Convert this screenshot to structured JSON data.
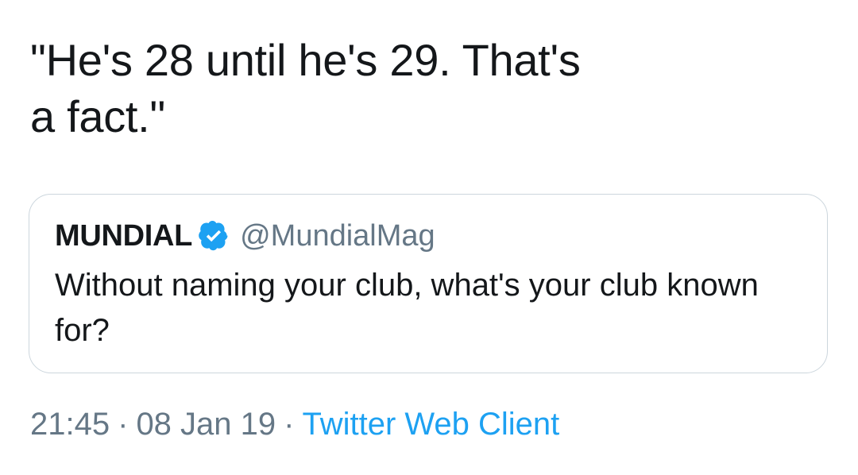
{
  "tweet": {
    "text": "\"He's 28 until he's 29. That's\na fact.\""
  },
  "quoted_tweet": {
    "name": "MUNDIAL",
    "handle": "@MundialMag",
    "verified_icon": "verified-badge-icon",
    "text": "Without naming your club, what's your club known for?"
  },
  "meta": {
    "time": "21:45",
    "separator": "·",
    "date": "08 Jan 19",
    "source": "Twitter Web Client"
  },
  "colors": {
    "text": "#14171a",
    "secondary": "#657786",
    "link": "#1da1f2",
    "border": "#ccd6dd",
    "verified": "#1da1f2"
  }
}
